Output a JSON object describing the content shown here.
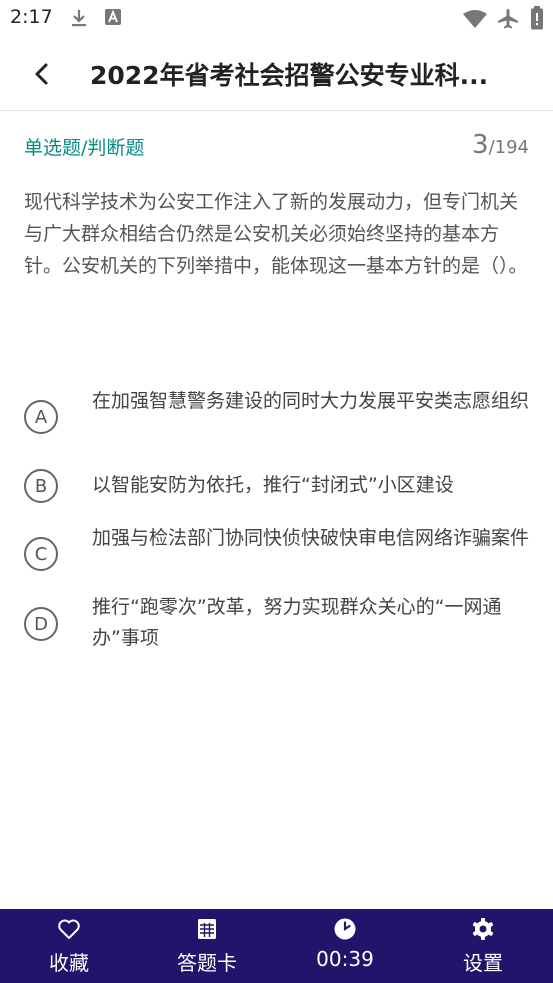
{
  "status_bar": {
    "time": "2:17"
  },
  "header": {
    "title": "2022年省考社会招警公安专业科..."
  },
  "question": {
    "type_label": "单选题/判断题",
    "current": "3",
    "total": "/194",
    "text": "现代科学技术为公安工作注入了新的发展动力，但专门机关与广大群众相结合仍然是公安机关必须始终坚持的基本方针。公安机关的下列举措中，能体现这一基本方针的是（）。"
  },
  "options": [
    {
      "letter": "A",
      "text": "在加强智慧警务建设的同时大力发展平安类志愿组织"
    },
    {
      "letter": "B",
      "text": "以智能安防为依托，推行“封闭式”小区建设"
    },
    {
      "letter": "C",
      "text": "加强与检法部门协同快侦快破快审电信网络诈骗案件"
    },
    {
      "letter": "D",
      "text": "推行“跑零次”改革，努力实现群众关心的“一网通办”事项"
    }
  ],
  "bottom_bar": {
    "favorite": "收藏",
    "answer_card": "答题卡",
    "timer": "00:39",
    "settings": "设置"
  },
  "colors": {
    "accent": "#0c8a84",
    "bottom_bar": "#24136a"
  },
  "icons": [
    "download-icon",
    "app-notification-icon",
    "wifi-icon",
    "airplane-icon",
    "battery-alert-icon",
    "back-arrow-icon",
    "heart-icon",
    "grid-card-icon",
    "clock-icon",
    "gear-icon"
  ]
}
